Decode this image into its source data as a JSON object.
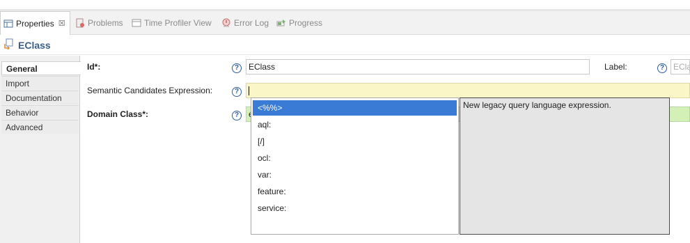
{
  "tabs": [
    {
      "label": "Properties",
      "icon": "properties-icon",
      "active": true
    },
    {
      "label": "Problems",
      "icon": "problems-icon"
    },
    {
      "label": "Time Profiler View",
      "icon": "view-icon"
    },
    {
      "label": "Error Log",
      "icon": "error-log-icon"
    },
    {
      "label": "Progress",
      "icon": "progress-icon"
    }
  ],
  "tab_close_glyph": "☒",
  "title": "EClass",
  "sidebar": {
    "items": [
      "General",
      "Import",
      "Documentation",
      "Behavior",
      "Advanced"
    ]
  },
  "form": {
    "id_label": "Id*:",
    "id_value": "EClass",
    "label_label": "Label:",
    "label_value": "ECla",
    "semantic_label": "Semantic Candidates Expression:",
    "semantic_value": "",
    "domain_label": "Domain Class*:",
    "domain_value": "e",
    "help_glyph": "?"
  },
  "autocomplete": {
    "items": [
      "<%%>",
      "aql:",
      "[/]",
      "ocl:",
      "var:",
      "feature:",
      "service:"
    ],
    "selected_index": 0,
    "description": "New legacy query language expression."
  },
  "colors": {
    "selection": "#3a7bd5",
    "title": "#3b5f8a",
    "help": "#2f5e9e"
  }
}
